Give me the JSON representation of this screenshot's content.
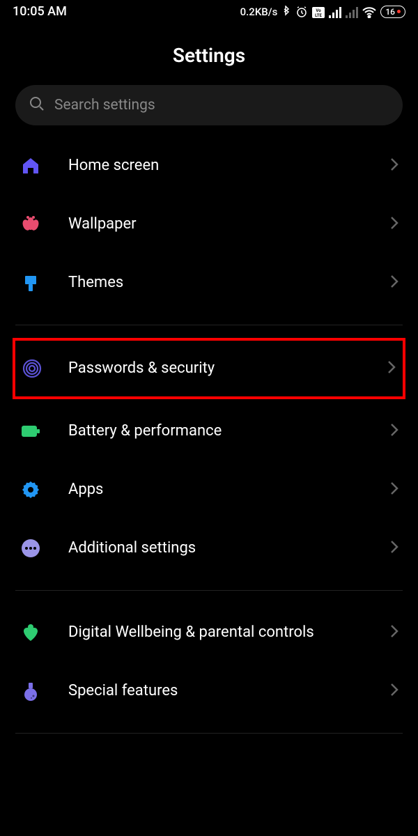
{
  "statusbar": {
    "time": "10:05 AM",
    "data_rate": "0.2KB/s",
    "battery_percent": "16"
  },
  "header": {
    "title": "Settings"
  },
  "search": {
    "placeholder": "Search settings"
  },
  "groups": [
    {
      "items": [
        {
          "id": "home-screen",
          "label": "Home screen",
          "icon": "home-icon",
          "color": "#6155f5"
        },
        {
          "id": "wallpaper",
          "label": "Wallpaper",
          "icon": "flower-icon",
          "color": "#e84c6f"
        },
        {
          "id": "themes",
          "label": "Themes",
          "icon": "brush-icon",
          "color": "#2196f3"
        }
      ]
    },
    {
      "items": [
        {
          "id": "passwords-security",
          "label": "Passwords & security",
          "icon": "fingerprint-icon",
          "color": "#5b52d4",
          "highlighted": true
        },
        {
          "id": "battery-performance",
          "label": "Battery & performance",
          "icon": "battery-icon",
          "color": "#2ecc71"
        },
        {
          "id": "apps",
          "label": "Apps",
          "icon": "gear-icon",
          "color": "#2196f3"
        },
        {
          "id": "additional-settings",
          "label": "Additional settings",
          "icon": "dots-icon",
          "color": "#9b95e8"
        }
      ]
    },
    {
      "items": [
        {
          "id": "digital-wellbeing",
          "label": "Digital Wellbeing & parental controls",
          "icon": "heart-icon",
          "color": "#2ecc71"
        },
        {
          "id": "special-features",
          "label": "Special features",
          "icon": "flask-icon",
          "color": "#7b6fe8"
        }
      ]
    }
  ]
}
